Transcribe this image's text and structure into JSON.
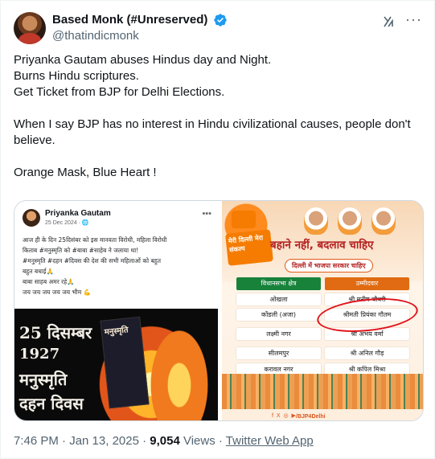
{
  "author": {
    "display_name": "Based Monk (#Unreserved)",
    "handle": "@thatindicmonk",
    "verified": true
  },
  "tweet": {
    "text": "Priyanka Gautam abuses Hindus day and Night.\nBurns Hindu scriptures.\nGet Ticket from BJP for Delhi Elections.\n\nWhen I say BJP has no interest in Hindu civilizational causes, people don't believe.\n\nOrange Mask, Blue Heart !"
  },
  "media_left": {
    "name": "Priyanka Gautam",
    "date": "25 Dec 2024 · 🌐",
    "lines": [
      "आज ही के दिन 25दिसंबर को इस मानवता विरोधी, महिला विरोधी",
      "किताब #मनुस्मृति को #बाबा #साहेब ने जलाया था!",
      "#मनुस्मृति #दहन #दिवस की देश की सभी महिलाओं को बहुत",
      "बहुत बधाई🙏",
      "बाबा साहब अमर रहे🙏",
      "जय जय जय जय जय भीम 💪"
    ],
    "photo_lines": [
      "25 दिसम्बर",
      "1927",
      "मनुस्मृति",
      "दहन दिवस"
    ],
    "book_title": "मनुस्मृति"
  },
  "media_right": {
    "badge": "मेरी दिल्ली मेरा संकल्प",
    "headline": "बहाने नहीं, बदलाव चाहिए",
    "subhead": "दिल्ली में भाजपा सरकार चाहिए",
    "col_left": "विधानसभा क्षेत्र",
    "col_right": "उम्मीदवार",
    "rows": [
      {
        "seat": "ओखला",
        "candidate": "श्री मनीष चौधरी"
      },
      {
        "seat": "कोंडली (अजा)",
        "candidate": "श्रीमती प्रियंका गौतम"
      },
      {
        "seat": "लक्ष्मी नगर",
        "candidate": "श्री अभय वर्मा"
      },
      {
        "seat": "सीलमपुर",
        "candidate": "श्री अनिल गौड़"
      },
      {
        "seat": "करावल नगर",
        "candidate": "श्री कपिल मिश्रा"
      }
    ],
    "footer_handle": "/BJP4Delhi",
    "footer_icons": "f X ◎ ▶"
  },
  "meta": {
    "time": "7:46 PM · Jan 13, 2025 · ",
    "views_count": "9,054",
    "views_label": " Views · ",
    "source": "Twitter Web App"
  },
  "colors": {
    "verified": "#1d9bf0",
    "text": "#0f1419",
    "secondary": "#536471"
  }
}
